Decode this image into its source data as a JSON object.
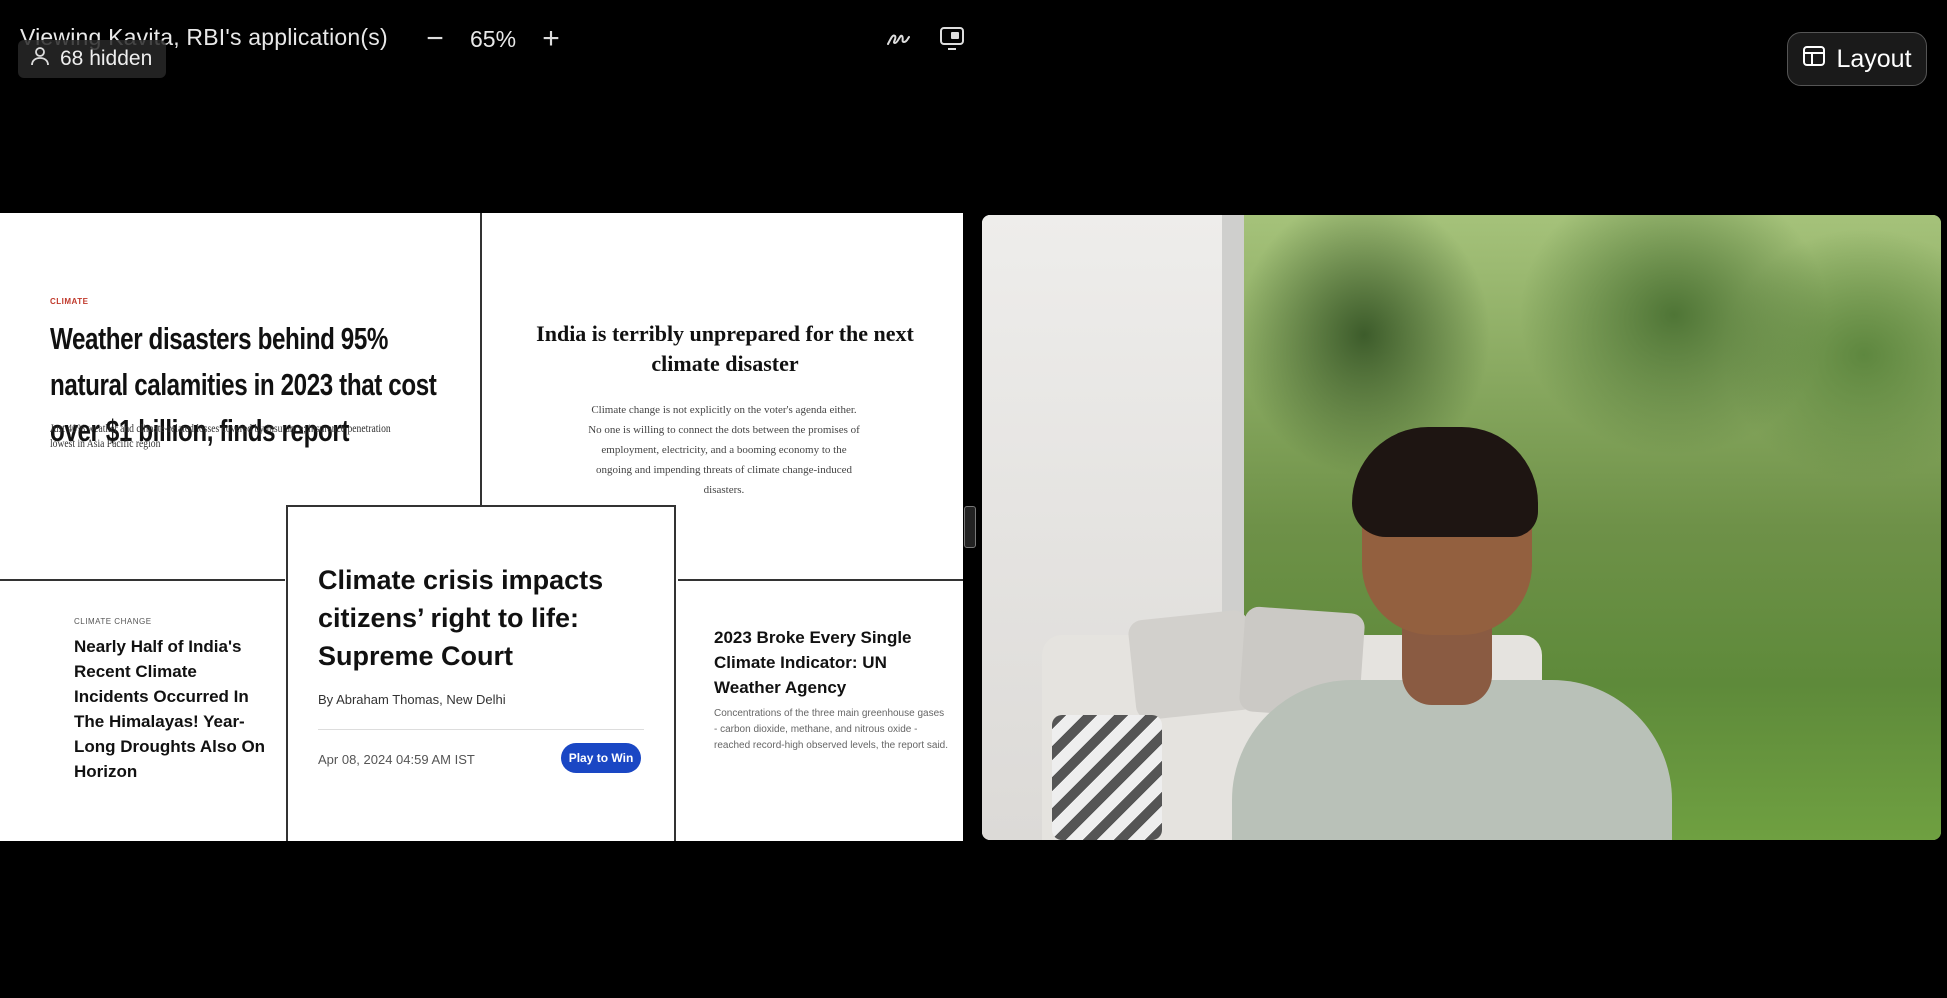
{
  "viewing": {
    "title": "Viewing Kavita, RBI's application(s)",
    "hidden_count": "68 hidden",
    "zoom_minus": "−",
    "zoom_value": "65%",
    "zoom_plus": "+"
  },
  "layout_button": {
    "label": "Layout"
  },
  "shared_screen": {
    "card1": {
      "kicker": "CLIMATE",
      "headline": "Weather disasters behind 95% natural calamities in 2023 that cost over $1 billion, finds report",
      "sub": "Just 40% weather and climate-related losses covered by insurance; insurance penetration lowest in Asia Pacific region"
    },
    "card2": {
      "headline": "India is terribly unprepared for the next climate disaster",
      "sub": "Climate change is not explicitly on the voter's agenda either. No one is willing to connect the dots between the promises of employment, electricity, and a booming economy to the ongoing and impending threats of climate change-induced disasters."
    },
    "card3": {
      "kicker": "CLIMATE CHANGE",
      "headline": "Nearly Half of India's Recent Climate Incidents Occurred In The Himalayas! Year-Long Droughts Also On Horizon"
    },
    "card4": {
      "headline": "Climate crisis impacts citizens’ right to life: Supreme Court",
      "byline": "By Abraham Thomas, New Delhi",
      "date": "Apr 08, 2024 04:59 AM IST",
      "button": "Play to Win"
    },
    "card5": {
      "headline": "2023 Broke Every Single Climate Indicator: UN Weather Agency",
      "sub": "Concentrations of the three main greenhouse gases - carbon dioxide, methane, and nitrous oxide - reached record-high observed levels, the report said."
    }
  },
  "colors": {
    "background": "#000000",
    "play_button": "#1a47c4",
    "kicker_red": "#c0392b"
  }
}
